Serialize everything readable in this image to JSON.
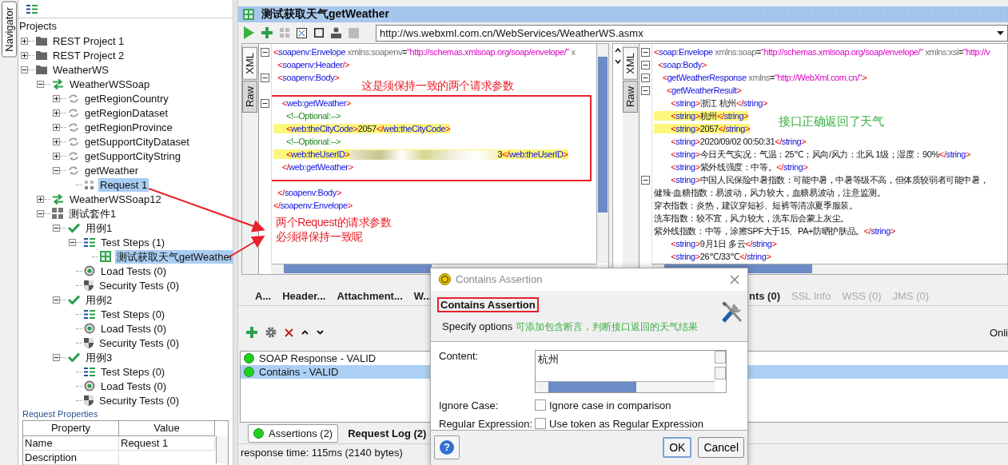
{
  "navigator": {
    "tab": "Navigator",
    "root": "Projects",
    "tree": [
      {
        "label": "REST Project 1",
        "kind": "folder",
        "expanded": false,
        "selected": false
      },
      {
        "label": "REST Project 2",
        "kind": "folder",
        "expanded": false,
        "selected": false
      },
      {
        "label": "WeatherWS",
        "kind": "folder",
        "expanded": true,
        "selected": false,
        "children": [
          {
            "label": "WeatherWSSoap",
            "kind": "interface",
            "expanded": true,
            "selected": false,
            "children": [
              {
                "label": "getRegionCountry",
                "kind": "operation",
                "expanded": false,
                "selected": false
              },
              {
                "label": "getRegionDataset",
                "kind": "operation",
                "expanded": false,
                "selected": false
              },
              {
                "label": "getRegionProvince",
                "kind": "operation",
                "expanded": false,
                "selected": false
              },
              {
                "label": "getSupportCityDataset",
                "kind": "operation",
                "expanded": false,
                "selected": false
              },
              {
                "label": "getSupportCityString",
                "kind": "operation",
                "expanded": false,
                "selected": false
              },
              {
                "label": "getWeather",
                "kind": "operation",
                "expanded": true,
                "selected": false,
                "children": [
                  {
                    "label": "Request 1",
                    "kind": "request",
                    "selected": true
                  }
                ]
              }
            ]
          },
          {
            "label": "WeatherWSSoap12",
            "kind": "interface",
            "expanded": false,
            "selected": false
          },
          {
            "label": "测试套件1",
            "kind": "suite",
            "expanded": true,
            "selected": false,
            "children": [
              {
                "label": "用例1",
                "kind": "testcase",
                "expanded": true,
                "selected": false,
                "children": [
                  {
                    "label": "Test Steps (1)",
                    "kind": "steps",
                    "expanded": true,
                    "selected": false,
                    "children": [
                      {
                        "label": "测试获取天气getWeather",
                        "kind": "teststep",
                        "selected": true
                      }
                    ]
                  },
                  {
                    "label": "Load Tests (0)",
                    "kind": "loadtest",
                    "selected": false
                  },
                  {
                    "label": "Security Tests (0)",
                    "kind": "security",
                    "selected": false
                  }
                ]
              },
              {
                "label": "用例2",
                "kind": "testcase",
                "expanded": true,
                "selected": false,
                "children": [
                  {
                    "label": "Test Steps (0)",
                    "kind": "steps",
                    "selected": false
                  },
                  {
                    "label": "Load Tests (0)",
                    "kind": "loadtest",
                    "selected": false
                  },
                  {
                    "label": "Security Tests (0)",
                    "kind": "security",
                    "selected": false
                  }
                ]
              },
              {
                "label": "用例3",
                "kind": "testcase",
                "expanded": true,
                "selected": false,
                "children": [
                  {
                    "label": "Test Steps (0)",
                    "kind": "steps",
                    "selected": false
                  },
                  {
                    "label": "Load Tests (0)",
                    "kind": "loadtest",
                    "selected": false
                  },
                  {
                    "label": "Security Tests (0)",
                    "kind": "security",
                    "selected": false
                  }
                ]
              }
            ]
          }
        ]
      }
    ]
  },
  "request_properties": {
    "title": "Request Properties",
    "columns": [
      "Property",
      "Value"
    ],
    "rows": [
      [
        "Name",
        "Request 1"
      ],
      [
        "Description"
      ]
    ]
  },
  "editor": {
    "title": "测试获取天气getWeather",
    "url": "http://ws.webxml.com.cn/WebServices/WeatherWS.asmx",
    "request_tabs": [
      {
        "label": "XML",
        "selected": true
      },
      {
        "label": "Raw",
        "selected": false
      }
    ],
    "response_tabs": [
      {
        "label": "XML",
        "selected": true
      },
      {
        "label": "Raw",
        "selected": false
      }
    ],
    "request_lines": [
      {
        "kind": "code",
        "fold": true,
        "highlight": false,
        "text": "<soapenv:Envelope xmlns:soapenv=\"http://schemas.xmlsoap.org/soap/envelope/\" x"
      },
      {
        "kind": "code",
        "fold": false,
        "highlight": false,
        "text": "  <soapenv:Header/>"
      },
      {
        "kind": "code",
        "fold": true,
        "highlight": false,
        "text": "  <soapenv:Body>"
      },
      {
        "kind": "blank"
      },
      {
        "kind": "code",
        "fold": true,
        "highlight": false,
        "text": "    <web:getWeather>"
      },
      {
        "kind": "code",
        "fold": false,
        "highlight": false,
        "text": "      <!--Optional:-->"
      },
      {
        "kind": "code",
        "fold": false,
        "highlight": true,
        "text": "      <web:theCityCode>2057</web:theCityCode>"
      },
      {
        "kind": "code",
        "fold": false,
        "highlight": false,
        "text": "      <!--Optional:-->"
      },
      {
        "kind": "redacted",
        "fold": false,
        "highlight": true,
        "before": "      <web:theUserID>",
        "after": "3</web:theUserID>"
      },
      {
        "kind": "code",
        "fold": false,
        "highlight": false,
        "text": "    </web:getWeather>"
      },
      {
        "kind": "blank"
      },
      {
        "kind": "code",
        "fold": false,
        "highlight": false,
        "text": "  </soapenv:Body>"
      },
      {
        "kind": "code",
        "fold": false,
        "highlight": false,
        "text": "</soapenv:Envelope>"
      }
    ],
    "response_lines": [
      {
        "kind": "code",
        "fold": true,
        "highlight": false,
        "text": "<soap:Envelope xmlns:soap=\"http://schemas.xmlsoap.org/soap/envelope/\" xmlns:xsi=\"http://v"
      },
      {
        "kind": "code",
        "fold": true,
        "highlight": false,
        "text": "  <soap:Body>"
      },
      {
        "kind": "code",
        "fold": true,
        "highlight": false,
        "text": "    <getWeatherResponse xmlns=\"http://WebXml.com.cn/\">"
      },
      {
        "kind": "code",
        "fold": true,
        "highlight": false,
        "text": "      <getWeatherResult>"
      },
      {
        "kind": "code",
        "fold": false,
        "highlight": false,
        "text": "        <string>浙江 杭州</string>"
      },
      {
        "kind": "code",
        "fold": false,
        "highlight": true,
        "text": "        <string>杭州</string>"
      },
      {
        "kind": "code",
        "fold": false,
        "highlight": true,
        "text": "        <string>2057</string>"
      },
      {
        "kind": "code",
        "fold": false,
        "highlight": false,
        "text": "        <string>2020/09/02 00:50:31</string>"
      },
      {
        "kind": "code",
        "fold": false,
        "highlight": false,
        "text": "        <string>今日天气实况：气温：25℃；风向/风力：北风 1级；湿度：90%</string>"
      },
      {
        "kind": "code",
        "fold": false,
        "highlight": false,
        "text": "        <string>紫外线强度：中等。</string>"
      },
      {
        "kind": "code",
        "fold": true,
        "highlight": false,
        "text": "        <string>中国人民保险中暑指数：可能中暑，中暑等级不高，但体质较弱者可能中暑，"
      },
      {
        "kind": "code",
        "fold": false,
        "highlight": false,
        "text": "健臻·血糖指数：易波动，风力较大，血糖易波动，注意监测。"
      },
      {
        "kind": "code",
        "fold": false,
        "highlight": false,
        "text": "穿衣指数：炎热，建议穿短衫、短裤等清凉夏季服装。"
      },
      {
        "kind": "code",
        "fold": false,
        "highlight": false,
        "text": "洗车指数：较不宜，风力较大，洗车后会蒙上灰尘。"
      },
      {
        "kind": "code",
        "fold": false,
        "highlight": false,
        "text": "紫外线指数：中等，涂擦SPF大于15、PA+防晒护肤品。</string>"
      },
      {
        "kind": "code",
        "fold": false,
        "highlight": false,
        "text": "        <string>9月1日 多云</string>"
      },
      {
        "kind": "code",
        "fold": false,
        "highlight": false,
        "text": "        <string>26℃/33℃</string>"
      }
    ],
    "tabs_left": [
      {
        "label": "A...",
        "disabled": false
      },
      {
        "label": "Header...",
        "disabled": false
      },
      {
        "label": "Attachment...",
        "disabled": false
      },
      {
        "label": "W...",
        "disabled": false
      }
    ],
    "tabs_right": [
      {
        "label": "nts (0)",
        "disabled": false
      },
      {
        "label": "SSL Info",
        "disabled": true
      },
      {
        "label": "WSS (0)",
        "disabled": true
      },
      {
        "label": "JMS (0)",
        "disabled": true
      }
    ],
    "online_label": "Onli",
    "assertions": [
      {
        "label": "SOAP Response - VALID",
        "selected": false
      },
      {
        "label": "Contains - VALID",
        "selected": true
      }
    ],
    "bottom_tabs": [
      {
        "label": "Assertions (2)",
        "selected": true
      },
      {
        "label": "Request Log (2)",
        "selected": false
      }
    ],
    "status": "response time: 115ms (2140 bytes)"
  },
  "dialog": {
    "title": "Contains Assertion",
    "heading": "Contains Assertion",
    "subheading": "Specify options",
    "content_label": "Content:",
    "content_value": "杭州",
    "options": [
      {
        "label": "Ignore Case:",
        "text": "Ignore case in comparison",
        "checked": false
      },
      {
        "label": "Regular Expression:",
        "text": "Use token as Regular Expression",
        "checked": false
      }
    ],
    "help": "?",
    "ok": "OK",
    "cancel": "Cancel"
  },
  "annotations": {
    "request_note": "这是须保持一致的两个请求参数",
    "center_note": [
      "两个Request的请求参数",
      "必须得保持一致呢"
    ],
    "response_note": "接口正确返回了天气",
    "dialog_note": "可添加包含断言，判断接口返回的天气结果"
  }
}
